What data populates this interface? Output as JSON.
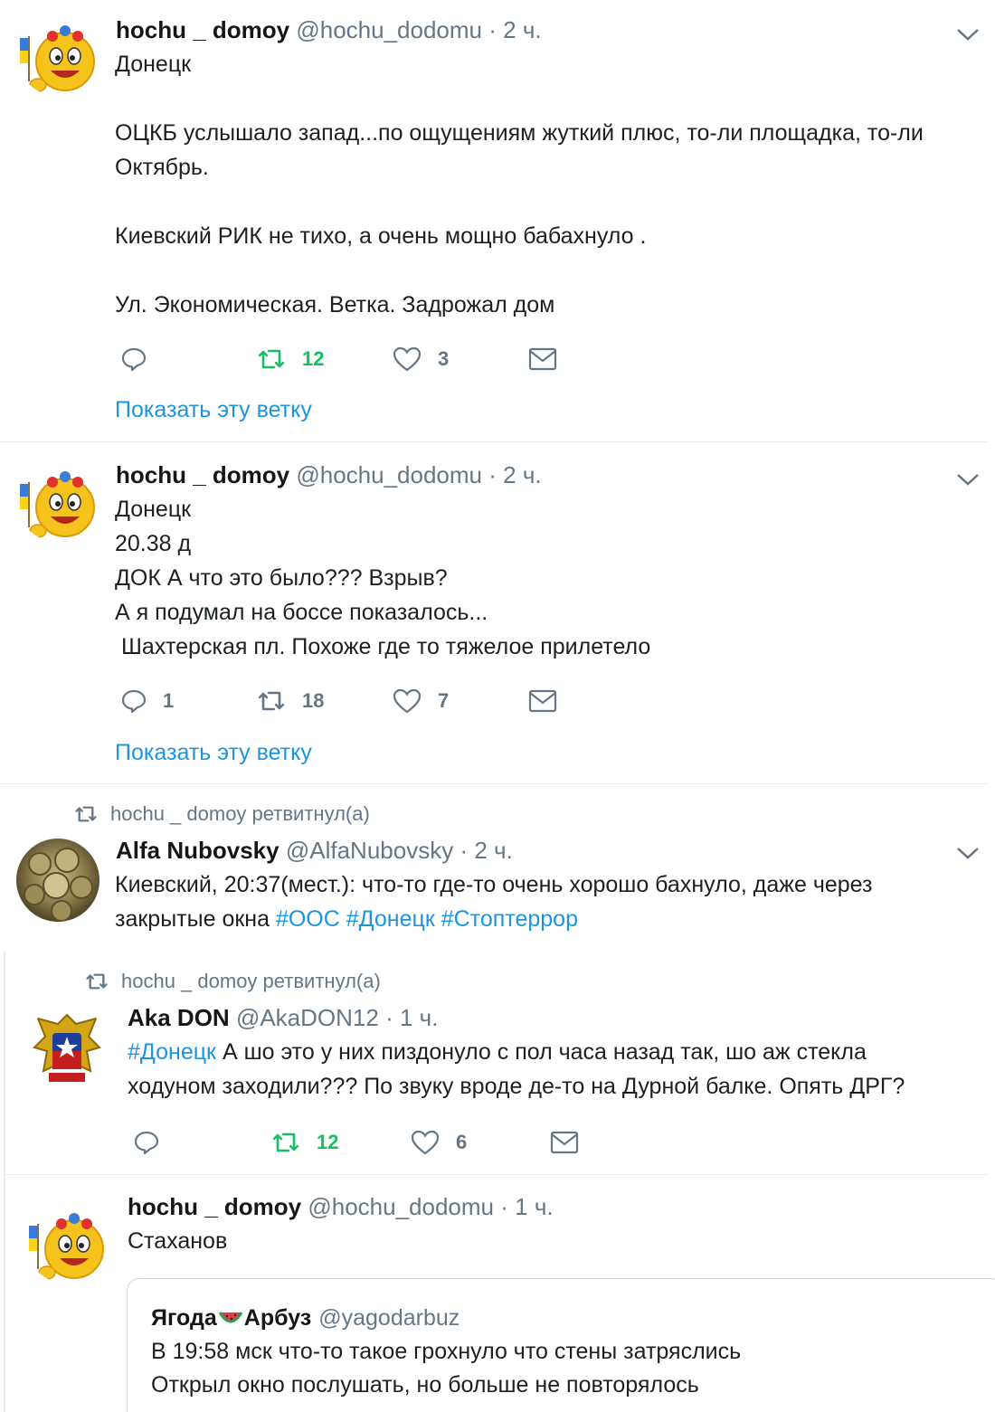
{
  "tweets": [
    {
      "name": "hochu _ domoy",
      "handle": "@hochu_dodomu",
      "dot": "·",
      "time": "2 ч.",
      "body": "Донецк\n\nОЦКБ услышало запад...по ощущениям жуткий плюс, то-ли площадка, то-ли\nОктябрь.\n\nКиевский РИК не тихо, а очень мощно бабахнуло .\n\nУл. Экономическая. Ветка. Задрожал дом",
      "reply_count": "",
      "retweet_count": "12",
      "like_count": "3",
      "show_thread": "Показать эту ветку"
    },
    {
      "name": "hochu _ domoy",
      "handle": "@hochu_dodomu",
      "dot": "·",
      "time": "2 ч.",
      "body": "Донецк\n20.38 д\nДОК А что это было??? Взрыв?\nА я подумал на боссе показалось...\n Шахтерская пл. Похоже где то тяжелое прилетело",
      "reply_count": "1",
      "retweet_count": "18",
      "like_count": "7",
      "show_thread": "Показать эту ветку"
    },
    {
      "retweet_note": "hochu _ domoy ретвитнул(а)",
      "name": "Alfa Nubovsky",
      "handle": "@AlfaNubovsky",
      "dot": "·",
      "time": "2 ч.",
      "body_line1": "Киевский, 20:37(мест.): что-то где-то очень хорошо бахнуло, даже через",
      "body_line2_text": "закрытые окна ",
      "hashtags": [
        "#ООС",
        "#Донецк",
        "#Стоптеррор"
      ]
    },
    {
      "retweet_note": "hochu _ domoy ретвитнул(а)",
      "name": "Aka DON",
      "handle": "@AkaDON12",
      "dot": "·",
      "time": "1 ч.",
      "hashtag": "#Донецк",
      "body_line1_rest": " А шо это у них пиздонуло с пол часа назад так, шо аж стекла",
      "body_line2": "ходуном заходили??? По звуку вроде де-то на Дурной балке. Опять ДРГ?",
      "reply_count": "",
      "retweet_count": "12",
      "like_count": "6"
    },
    {
      "name": "hochu _ domoy",
      "handle": "@hochu_dodomu",
      "dot": "·",
      "time": "1 ч.",
      "body": "Стаханов",
      "quote": {
        "name_part1": "Ягода",
        "name_part2": "Арбуз",
        "handle": "@yagodarbuz",
        "body": "В 19:58 мск что-то такое грохнуло что стены затряслись\nОткрыл окно послушать, но больше не повторялось"
      }
    }
  ],
  "colors": {
    "text": "#14171a",
    "muted": "#657786",
    "link": "#1b95e0",
    "retweet_green": "#17bf63",
    "border": "#e6ecf0"
  },
  "icons": [
    "reply-icon",
    "retweet-icon",
    "like-icon",
    "dm-icon",
    "chevron-down-icon",
    "watermelon-icon"
  ]
}
